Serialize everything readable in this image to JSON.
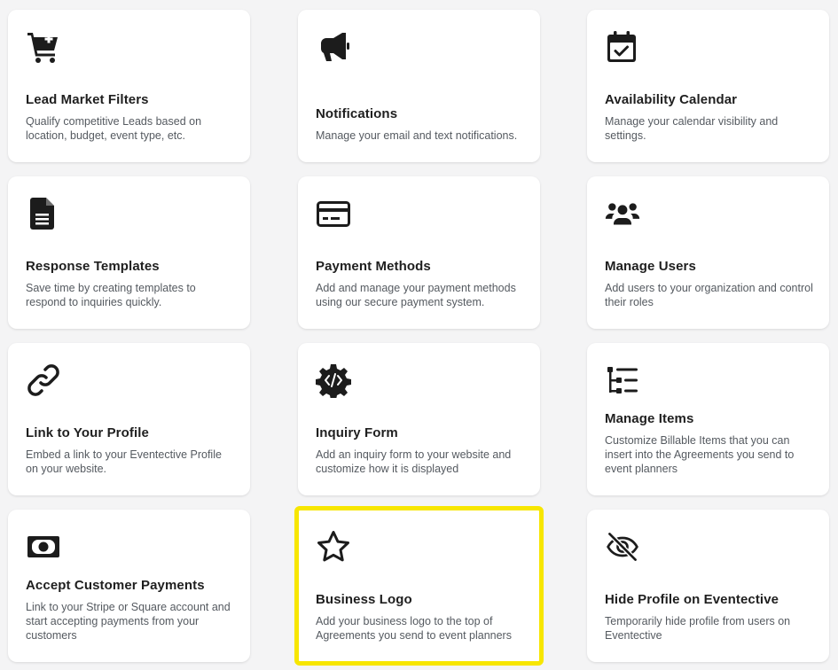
{
  "cards": [
    {
      "title": "Lead Market Filters",
      "description": "Qualify competitive Leads based on location, budget, event type, etc.",
      "icon": "cart-plus-icon"
    },
    {
      "title": "Notifications",
      "description": "Manage your email and text notifications.",
      "icon": "megaphone-icon"
    },
    {
      "title": "Availability Calendar",
      "description": "Manage your calendar visibility and settings.",
      "icon": "calendar-check-icon"
    },
    {
      "title": "Response Templates",
      "description": "Save time by creating templates to respond to inquiries quickly.",
      "icon": "document-icon"
    },
    {
      "title": "Payment Methods",
      "description": "Add and manage your payment methods using our secure payment system.",
      "icon": "credit-card-icon"
    },
    {
      "title": "Manage Users",
      "description": "Add users to your organization and control their roles",
      "icon": "users-icon"
    },
    {
      "title": "Link to Your Profile",
      "description": "Embed a link to your Eventective Profile on your website.",
      "icon": "link-icon"
    },
    {
      "title": "Inquiry Form",
      "description": "Add an inquiry form to your website and customize how it is displayed",
      "icon": "code-gear-icon"
    },
    {
      "title": "Manage Items",
      "description": "Customize Billable Items that you can insert into the Agreements you send to event planners",
      "icon": "list-tree-icon"
    },
    {
      "title": "Accept Customer Payments",
      "description": "Link to your Stripe or Square account and start accepting payments from your customers",
      "icon": "money-bill-icon"
    },
    {
      "title": "Business Logo",
      "description": "Add your business logo to the top of Agreements you send to event planners",
      "icon": "star-icon"
    },
    {
      "title": "Hide Profile on Eventective",
      "description": "Temporarily hide profile from users on Eventective",
      "icon": "eye-slash-icon"
    }
  ],
  "highlight_color": "#f7e600"
}
